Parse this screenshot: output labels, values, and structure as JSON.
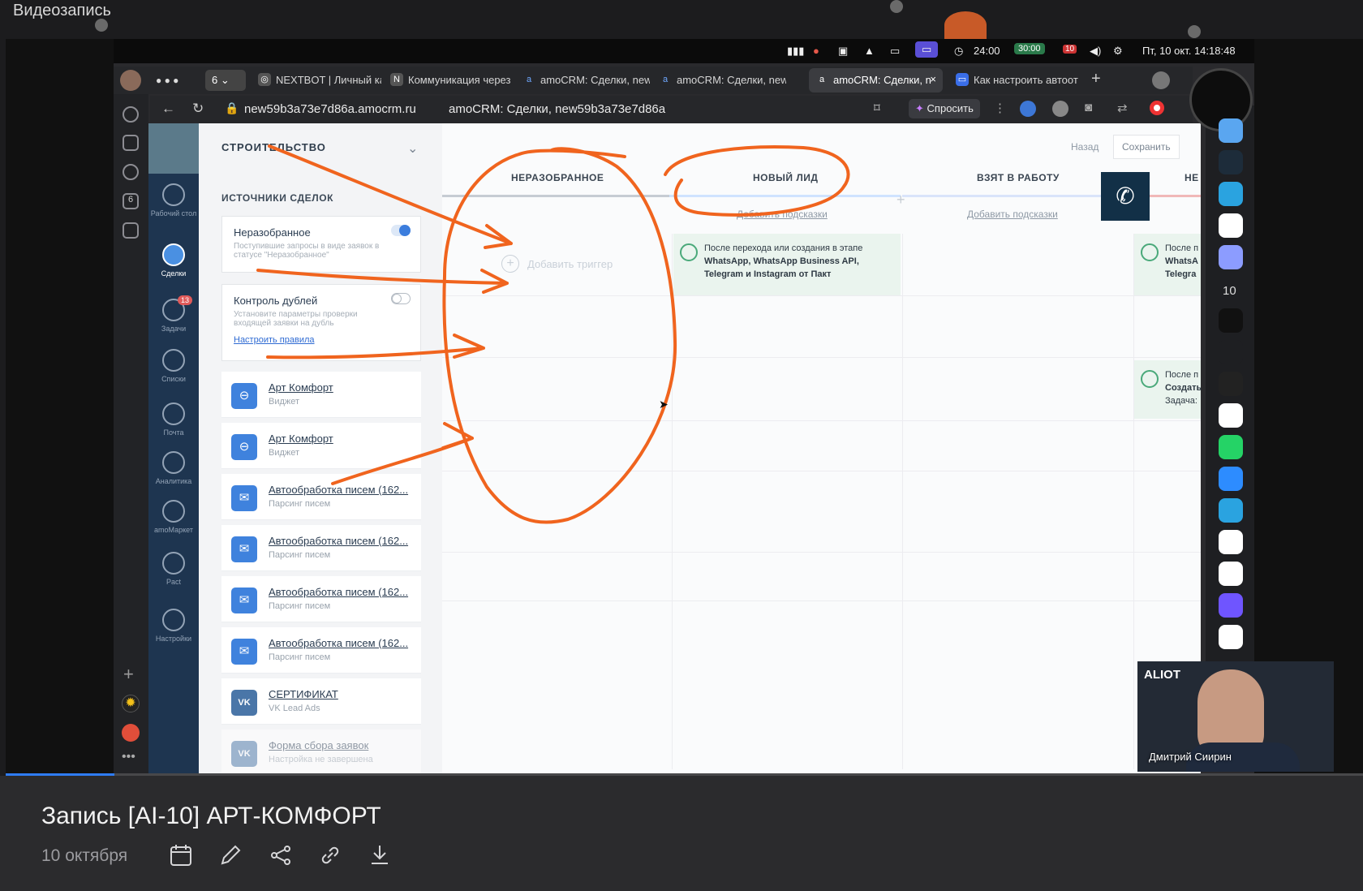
{
  "recording_label": "Видеозапись",
  "mac_menubar": {
    "timer": "24:00",
    "battery": "30:00",
    "calendar_day": "10",
    "datetime": "Пт, 10 окт. 14:18:48"
  },
  "browser": {
    "tab_group_count": "6",
    "tabs": [
      {
        "label": "NEXTBOT | Личный ка",
        "icon": "nextbot-icon"
      },
      {
        "label": "Коммуникация через",
        "icon": "notion-icon"
      },
      {
        "label": "amoCRM: Сделки, new",
        "icon": "amocrm-icon"
      },
      {
        "label": "amoCRM: Сделки, new",
        "icon": "amocrm-icon"
      },
      {
        "label": "amoCRM: Сделки, n",
        "icon": "amocrm-icon"
      },
      {
        "label": "Как настроить автоот",
        "icon": "chat-icon"
      }
    ],
    "url": "new59b3a73e7d86a.amocrm.ru",
    "page_title": "amoCRM: Сделки, new59b3a73e7d86a",
    "ask_button": "Спросить"
  },
  "amo_nav": [
    {
      "label": "Рабочий стол",
      "icon": "dashboard-icon"
    },
    {
      "label": "Сделки",
      "icon": "deals-icon"
    },
    {
      "label": "Задачи",
      "icon": "tasks-icon",
      "badge": "13"
    },
    {
      "label": "Списки",
      "icon": "lists-icon"
    },
    {
      "label": "Почта",
      "icon": "mail-icon"
    },
    {
      "label": "Аналитика",
      "icon": "analytics-icon"
    },
    {
      "label": "amoМаркет",
      "icon": "market-icon"
    },
    {
      "label": "Pact",
      "icon": "pact-icon"
    },
    {
      "label": "Настройки",
      "icon": "settings-icon"
    }
  ],
  "panel": {
    "pipeline_name": "СТРОИТЕЛЬСТВО",
    "sources_title": "ИСТОЧНИКИ СДЕЛОК",
    "unsorted": {
      "title": "Неразобранное",
      "desc": "Поступившие запросы в виде заявок в статусе \"Неразобранное\"",
      "enabled": true
    },
    "duplicates": {
      "title": "Контроль дублей",
      "desc": "Установите параметры проверки входящей заявки на дубль",
      "link": "Настроить правила",
      "enabled": false
    },
    "sources": [
      {
        "name": "Арт Комфорт",
        "sub": "Виджет",
        "icon": "widget-icon"
      },
      {
        "name": "Арт Комфорт",
        "sub": "Виджет",
        "icon": "widget-icon"
      },
      {
        "name": "Автообработка писем (162...",
        "sub": "Парсинг писем",
        "icon": "email-icon"
      },
      {
        "name": "Автообработка писем (162...",
        "sub": "Парсинг писем",
        "icon": "email-icon"
      },
      {
        "name": "Автообработка писем (162...",
        "sub": "Парсинг писем",
        "icon": "email-icon"
      },
      {
        "name": "Автообработка писем (162...",
        "sub": "Парсинг писем",
        "icon": "email-icon"
      },
      {
        "name": "СЕРТИФИКАТ",
        "sub": "VK Lead Ads",
        "icon": "vk-icon"
      },
      {
        "name": "Форма сбора заявок",
        "sub": "Настройка не завершена",
        "icon": "vk-icon"
      }
    ]
  },
  "board": {
    "back_button": "Назад",
    "save_button": "Сохранить",
    "columns": [
      {
        "title": "НЕРАЗОБРАННОЕ",
        "hint": ""
      },
      {
        "title": "НОВЫЙ ЛИД",
        "hint": "Добавить подсказки"
      },
      {
        "title": "ВЗЯТ В РАБОТУ",
        "hint": "Добавить подсказки"
      },
      {
        "title": "НЕ",
        "hint": ""
      }
    ],
    "add_trigger": "Добавить триггер",
    "trigger_new_lead": {
      "line1": "После перехода или создания в этапе",
      "line2": "WhatsApp, WhatsApp Business API,",
      "line3": "Telegram и Instagram от Пакт"
    },
    "trigger_partial_1": {
      "line1": "После п",
      "line2": "WhatsA",
      "line3": "Telegra"
    },
    "trigger_partial_2": {
      "line1": "После п",
      "line2": "Создать",
      "line3": "Задача:"
    }
  },
  "camera": {
    "brand": "ALIOT",
    "name": "Дмитрий Сиирин"
  },
  "meeting": {
    "title": "Запись [AI-10] АРТ-КОМФОРТ",
    "date": "10 октября"
  },
  "progress_fraction": 0.08,
  "colors": {
    "annotation": "#f0641e",
    "amo_nav": "#1e3550",
    "accent": "#2f7cf6"
  }
}
